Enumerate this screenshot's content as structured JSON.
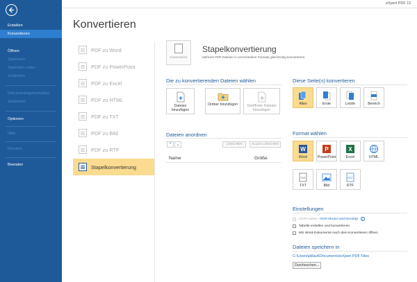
{
  "sidebar": {
    "items": [
      {
        "label": "Erstellen",
        "type": "section"
      },
      {
        "label": "Konvertieren",
        "type": "active"
      },
      {
        "label": "Öffnen",
        "type": "section"
      },
      {
        "label": "Speichern",
        "type": "sub"
      },
      {
        "label": "Speichern unter",
        "type": "sub"
      },
      {
        "label": "Schließen",
        "type": "sub"
      },
      {
        "label": "Dokumenteigenschaften",
        "type": "sub"
      },
      {
        "label": "Sicherheit",
        "type": "sub"
      },
      {
        "label": "Optionen",
        "type": "section"
      },
      {
        "label": "Hilfe",
        "type": "sub"
      },
      {
        "label": "Drucken",
        "type": "sub"
      },
      {
        "label": "Beenden",
        "type": "section"
      }
    ]
  },
  "app_title": "eXpert PDF 12",
  "page_title": "Konvertieren",
  "conversion_list": [
    {
      "label": "PDF zu Word",
      "selected": false
    },
    {
      "label": "PDF zu PowerPoint",
      "selected": false
    },
    {
      "label": "PDF zu Excel",
      "selected": false
    },
    {
      "label": "PDF zu HTML",
      "selected": false
    },
    {
      "label": "PDF zu TXT",
      "selected": false
    },
    {
      "label": "PDF zu Bild",
      "selected": false
    },
    {
      "label": "PDF zu RTF",
      "selected": false
    },
    {
      "label": "Stapelkonvertierung",
      "selected": true
    }
  ],
  "main": {
    "icon_label": "Konvertieren",
    "heading": "Stapelkonvertierung",
    "description": "Mehrere PDF-Dateien in verschiedene Formate gleichzeitig konvertieren."
  },
  "choose_files": {
    "title": "Die zu konvertierenden Dateien wählen",
    "buttons": [
      {
        "label": "Dateien hinzufügen",
        "icon": "file-add-icon",
        "disabled": false
      },
      {
        "label": "Ordner hinzufügen",
        "icon": "folder-add-icon",
        "disabled": false
      },
      {
        "label": "Geöffnete Dateien hinzufügen",
        "icon": "open-files-icon",
        "disabled": true
      }
    ]
  },
  "arrange": {
    "title": "Dateien anordnen",
    "delete_label": "LÖSCHEN",
    "delete_all_label": "ALLES LÖSCHEN",
    "col_name": "Name",
    "col_size": "Größe"
  },
  "pages": {
    "title": "Diese Seite(n) konvertieren",
    "buttons": [
      {
        "label": "Alles",
        "active": true
      },
      {
        "label": "Erste",
        "active": false
      },
      {
        "label": "Letzte",
        "active": false
      },
      {
        "label": "Bereich",
        "active": false
      }
    ]
  },
  "format": {
    "title": "Format wählen",
    "buttons": [
      {
        "label": "Word",
        "active": true,
        "color": "#2b5797",
        "letter": "W"
      },
      {
        "label": "PowerPoint",
        "active": false,
        "color": "#c43e1c",
        "letter": "P"
      },
      {
        "label": "Excel",
        "active": false,
        "color": "#1e7145",
        "letter": "X"
      },
      {
        "label": "HTML",
        "active": false,
        "color": "#2f7fd0",
        "letter": ""
      },
      {
        "label": "TXT",
        "active": false,
        "color": "#555555",
        "letter": "TXT"
      },
      {
        "label": "Bild",
        "active": false,
        "color": "#2f7fd0",
        "letter": ""
      },
      {
        "label": "RTF",
        "active": false,
        "color": "#2f7fd0",
        "letter": "RTF"
      }
    ]
  },
  "settings": {
    "title": "Einstellungen",
    "ocr_label": "OCR nutzen",
    "ocr_link": "OCR-Modul wird benötigt",
    "tables_label": "Tabelle erstellen und konvertieren",
    "open_word_label": "MS Word-Dokumente nach dem Konvertieren öffnen"
  },
  "save": {
    "title": "Dateien speichern in",
    "path": "C:\\Users\\pillaut\\Documents\\eXpert PDF Files",
    "browse_label": "Durchsuchen..."
  },
  "colors": {
    "sidebar": "#1e5a9a",
    "accent": "#2f7fd0",
    "highlight": "#fbdb8f"
  }
}
